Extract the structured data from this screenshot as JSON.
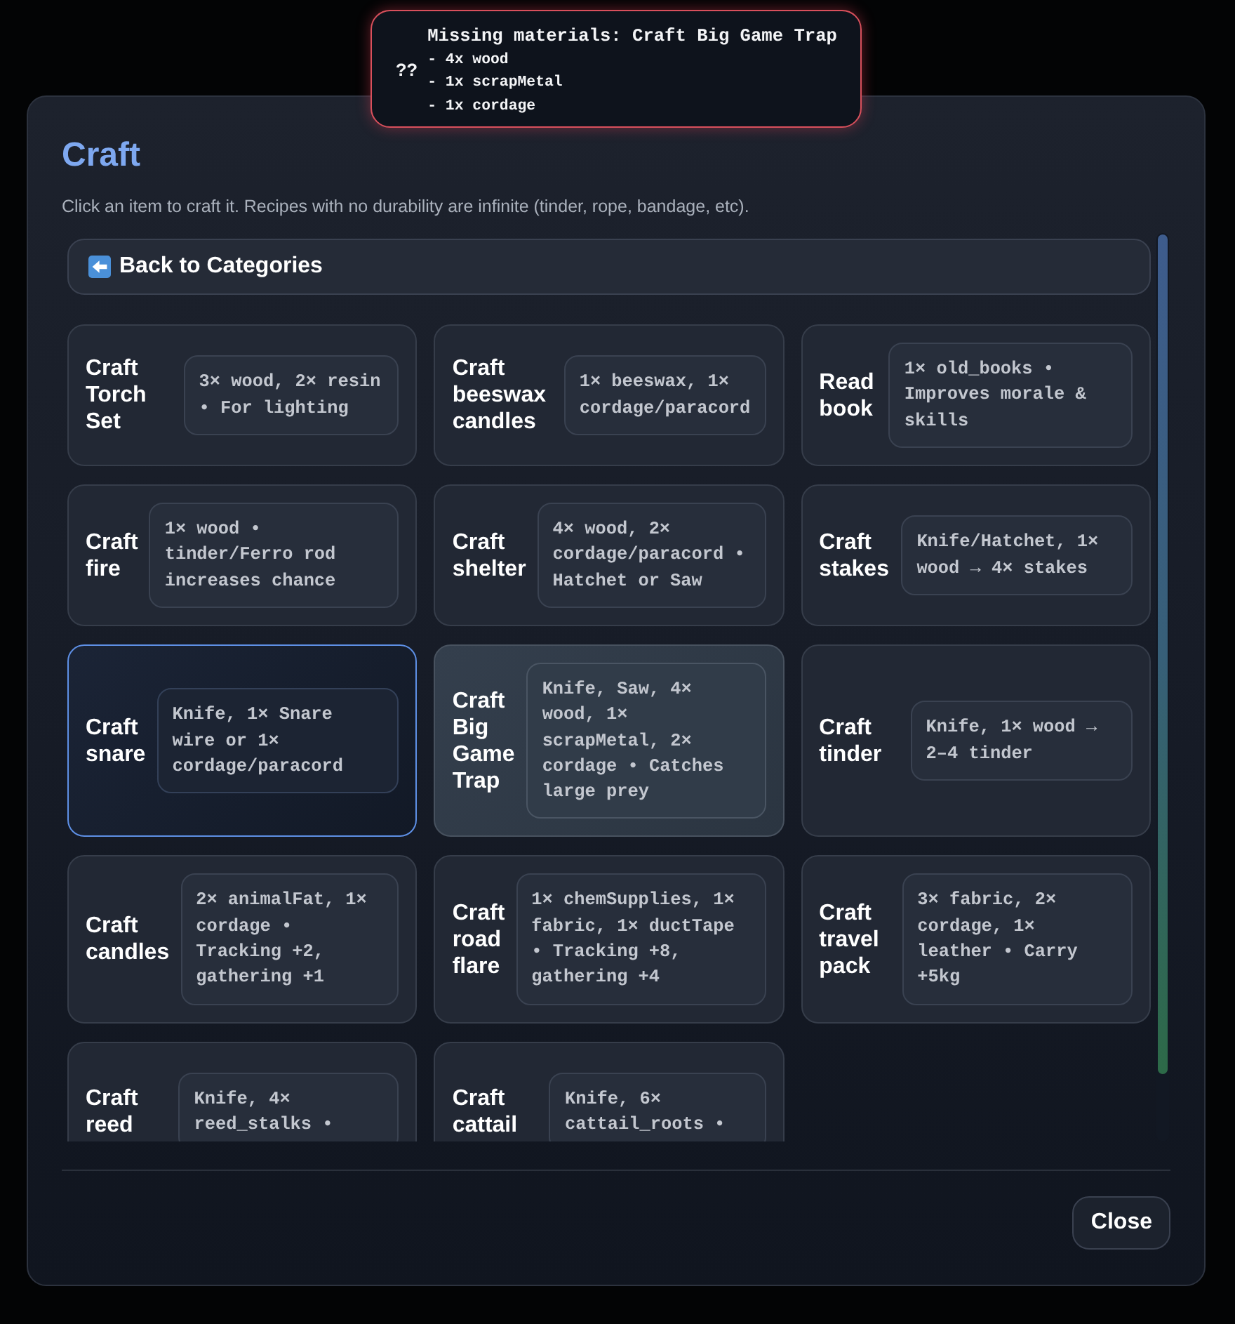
{
  "tooltip": {
    "icon_text": "??",
    "title": "Missing materials: Craft Big Game Trap",
    "lines": [
      "- 4x wood",
      "- 1x scrapMetal",
      "- 1x cordage"
    ]
  },
  "dialog": {
    "title": "Craft",
    "description": "Click an item to craft it. Recipes with no durability are infinite (tinder, rope, bandage, etc).",
    "back_button": {
      "label": "Back to Categories"
    },
    "recipes": [
      {
        "title": "Craft Torch Set",
        "requirements": "3× wood, 2× resin • For lighting",
        "selected": false,
        "hovered": false
      },
      {
        "title": "Craft beeswax candles",
        "requirements": "1× beeswax, 1× cordage/paracord",
        "selected": false,
        "hovered": false
      },
      {
        "title": "Read book",
        "requirements": "1× old_books • Improves morale & skills",
        "selected": false,
        "hovered": false
      },
      {
        "title": "Craft fire",
        "requirements": "1× wood • tinder/Ferro rod increases chance",
        "selected": false,
        "hovered": false
      },
      {
        "title": "Craft shelter",
        "requirements": "4× wood, 2× cordage/paracord • Hatchet or Saw",
        "selected": false,
        "hovered": false
      },
      {
        "title": "Craft stakes",
        "requirements": "Knife/Hatchet, 1× wood → 4× stakes",
        "selected": false,
        "hovered": false
      },
      {
        "title": "Craft snare",
        "requirements": "Knife, 1× Snare wire or 1× cordage/paracord",
        "selected": true,
        "hovered": false
      },
      {
        "title": "Craft Big Game Trap",
        "requirements": "Knife, Saw, 4× wood, 1× scrapMetal, 2× cordage • Catches large prey",
        "selected": false,
        "hovered": true
      },
      {
        "title": "Craft tinder",
        "requirements": "Knife, 1× wood → 2–4 tinder",
        "selected": false,
        "hovered": false
      },
      {
        "title": "Craft candles",
        "requirements": "2× animalFat, 1× cordage • Tracking +2, gathering +1",
        "selected": false,
        "hovered": false
      },
      {
        "title": "Craft road flare",
        "requirements": "1× chemSupplies, 1× fabric, 1× ductTape • Tracking +8, gathering +4",
        "selected": false,
        "hovered": false
      },
      {
        "title": "Craft travel pack",
        "requirements": "3× fabric, 2× cordage, 1× leather • Carry +5kg",
        "selected": false,
        "hovered": false
      },
      {
        "title": "Craft reed",
        "requirements": "Knife, 4× reed_stalks •",
        "selected": false,
        "hovered": false
      },
      {
        "title": "Craft cattail",
        "requirements": "Knife, 6× cattail_roots •",
        "selected": false,
        "hovered": false
      }
    ],
    "close_button": {
      "label": "Close"
    }
  }
}
